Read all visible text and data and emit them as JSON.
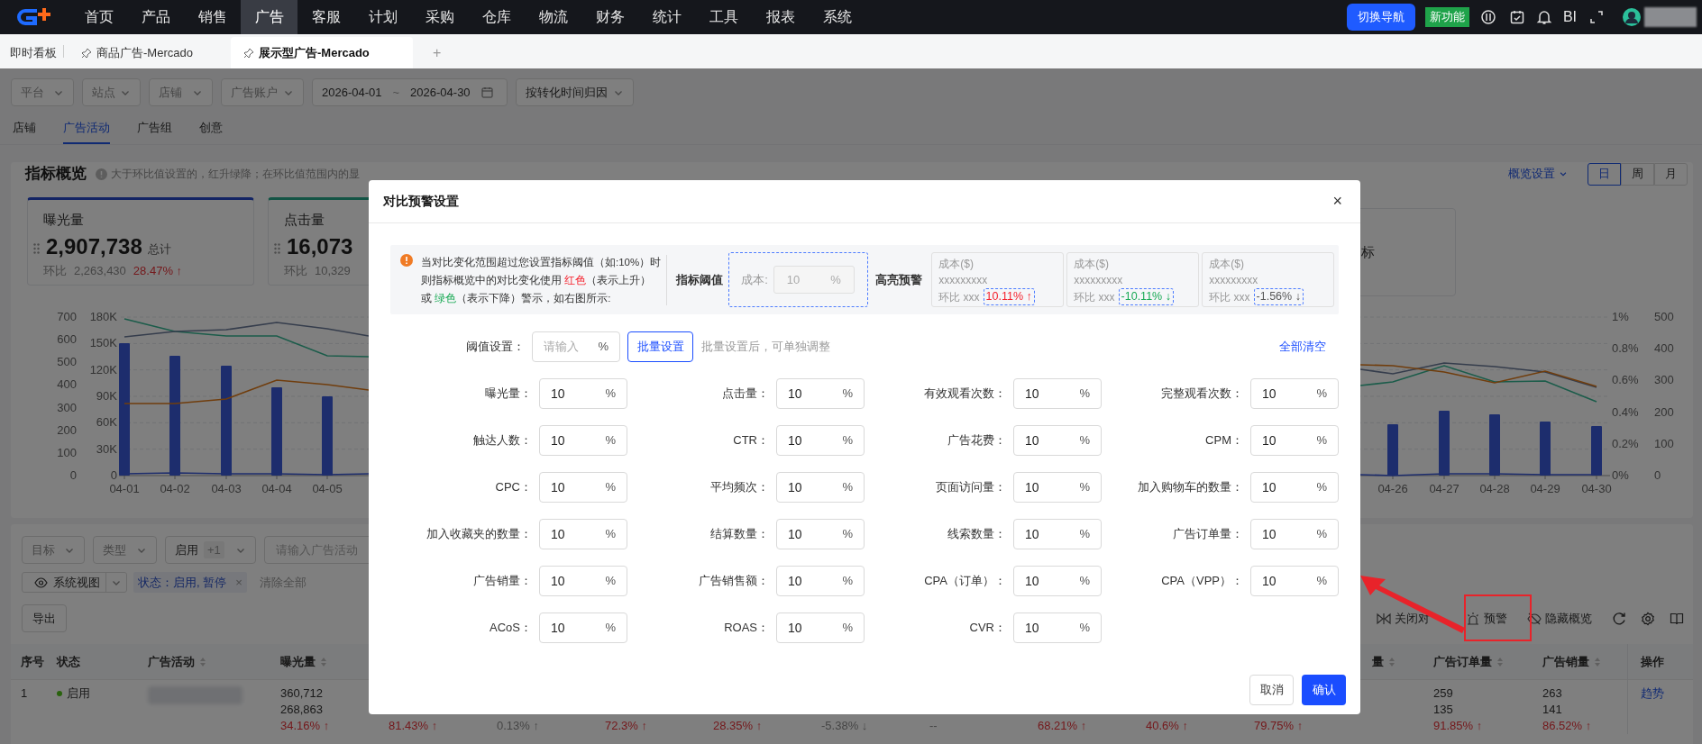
{
  "top_nav": {
    "items": [
      {
        "label": "首页",
        "selected": false
      },
      {
        "label": "产品",
        "selected": false
      },
      {
        "label": "销售",
        "selected": false
      },
      {
        "label": "广告",
        "selected": true
      },
      {
        "label": "客服",
        "selected": false
      },
      {
        "label": "计划",
        "selected": false
      },
      {
        "label": "采购",
        "selected": false
      },
      {
        "label": "仓库",
        "selected": false
      },
      {
        "label": "物流",
        "selected": false
      },
      {
        "label": "财务",
        "selected": false
      },
      {
        "label": "统计",
        "selected": false
      },
      {
        "label": "工具",
        "selected": false
      },
      {
        "label": "报表",
        "selected": false
      },
      {
        "label": "系统",
        "selected": false
      }
    ],
    "switch_button": "切换导航",
    "new_badge": "新功能",
    "bi_label": "BI"
  },
  "page_tabs": [
    {
      "label": "即时看板",
      "selected": false,
      "pinned": false
    },
    {
      "label": "商品广告-Mercado",
      "selected": false,
      "pinned": true
    },
    {
      "label": "展示型广告-Mercado",
      "selected": true,
      "pinned": true
    }
  ],
  "add_tab": "+",
  "filters": {
    "selects": [
      "平台",
      "站点",
      "店铺",
      "广告账户"
    ],
    "date_start": "2026-04-01",
    "date_separator": "~",
    "date_end": "2026-04-30",
    "attribution": "按转化时间归因"
  },
  "sub_tabs": [
    {
      "label": "店铺",
      "selected": false
    },
    {
      "label": "广告活动",
      "selected": true
    },
    {
      "label": "广告组",
      "selected": false
    },
    {
      "label": "创意",
      "selected": false
    }
  ],
  "overview": {
    "title": "指标概览",
    "hint": "大于环比值设置的，红升绿降；在环比值范围内的显",
    "settings": "概览设置",
    "periods": [
      {
        "label": "日",
        "selected": true
      },
      {
        "label": "周",
        "selected": false
      },
      {
        "label": "月",
        "selected": false
      }
    ],
    "cards": [
      {
        "title": "曝光量",
        "value": "2,907,738",
        "unit": "总计",
        "compare_label": "环比",
        "compare_value": "2,263,430",
        "change": "28.47% ↑",
        "alert": true
      },
      {
        "title": "点击量",
        "value": "16,073",
        "compare_label": "环比",
        "compare_value": "10,329"
      }
    ],
    "partial_card_text": "标",
    "chart": {
      "left_ticks": [
        "700",
        "600",
        "500",
        "400",
        "300",
        "200",
        "100",
        "0"
      ],
      "mid_ticks": [
        "180K",
        "150K",
        "120K",
        "90K",
        "60K",
        "30K",
        "0"
      ],
      "right_pct_ticks": [
        "1%",
        "0.8%",
        "0.6%",
        "0.4%",
        "0.2%",
        "0%"
      ],
      "right_ticks": [
        "500",
        "400",
        "300",
        "200",
        "100",
        "0"
      ],
      "x_labels_left": [
        "04-01",
        "04-02",
        "04-03",
        "04-04",
        "04-05"
      ],
      "x_labels_right": [
        "04-26",
        "04-27",
        "04-28",
        "04-29",
        "04-30"
      ]
    }
  },
  "table_filters": {
    "selects": [
      {
        "label": "目标"
      },
      {
        "label": "类型"
      },
      {
        "label": "启用",
        "extra": "+1"
      }
    ],
    "search_placeholder": "请输入广告活动",
    "view": "系统视图",
    "tag": "状态：启用, 暂停",
    "tag_close": "×",
    "clear": "清除全部",
    "export": "导出"
  },
  "table_actions": [
    {
      "label": "关闭对",
      "highlighted": false
    },
    {
      "label": "预警",
      "highlighted": true
    },
    {
      "label": "隐藏概览",
      "highlighted": false
    }
  ],
  "table": {
    "columns": [
      {
        "label": "序号",
        "sortable": false
      },
      {
        "label": "状态",
        "sortable": false
      },
      {
        "label": "广告活动",
        "sortable": true
      },
      {
        "label": "曝光量",
        "sortable": true
      },
      {},
      {},
      {},
      {},
      {},
      {},
      {},
      {},
      {
        "label": "量",
        "sortable": true
      },
      {
        "label": "广告订单量",
        "sortable": true
      },
      {
        "label": "广告销量",
        "sortable": true
      },
      {
        "label": "操作",
        "sortable": false
      }
    ],
    "rows": [
      {
        "cells": [
          {
            "kind": "text",
            "text": "1"
          },
          {
            "kind": "status",
            "text": "启用"
          },
          {
            "kind": "blurred"
          },
          {
            "kind": "metric",
            "lines": [
              "360,712",
              "268,863"
            ],
            "change": "34.16% ↑",
            "alert": true
          },
          {
            "kind": "change",
            "change": "81.43% ↑",
            "alert": true
          },
          {
            "kind": "change",
            "change": "0.13% ↑",
            "alert": false
          },
          {
            "kind": "change",
            "change": "72.3% ↑",
            "alert": true
          },
          {
            "kind": "change",
            "change": "28.35% ↑",
            "alert": true
          },
          {
            "kind": "change",
            "change": "-5.38% ↓",
            "alert": false
          },
          {
            "kind": "change",
            "change": "--",
            "alert": false
          },
          {
            "kind": "change",
            "change": "68.21% ↑",
            "alert": true
          },
          {
            "kind": "change",
            "change": "40.6% ↑",
            "alert": true
          },
          {
            "kind": "change",
            "change": "79.75% ↑",
            "alert": true
          },
          {
            "kind": "metric",
            "lines": [
              "259",
              "135"
            ],
            "change": "91.85% ↑",
            "alert": true
          },
          {
            "kind": "metric",
            "lines": [
              "263",
              "141"
            ],
            "change": "86.52% ↑",
            "alert": true
          },
          {
            "kind": "action",
            "text": "趋势"
          }
        ]
      }
    ]
  },
  "modal": {
    "title": "对比预警设置",
    "close": "×",
    "notice_lines": [
      [
        {
          "text": "当对比变化范围超过您设置指标阈值（如:10%）时"
        }
      ],
      [
        {
          "text": "则指标概览中的对比变化使用 "
        },
        {
          "text": "红色",
          "color": "#f5222d"
        },
        {
          "text": "（表示上升）"
        }
      ],
      [
        {
          "text": "或 "
        },
        {
          "text": "绿色",
          "color": "#1aaa55"
        },
        {
          "text": "（表示下降）警示，如右图所示:"
        }
      ]
    ],
    "threshold_label": "指标阈值",
    "sample_input": {
      "label": "成本:",
      "value": "10",
      "unit": "%",
      "disabled": true
    },
    "highlight_label": "高亮预警",
    "samples": [
      {
        "title": "成本($)",
        "value": "xxxxxxxxx",
        "compare": "环比 xxx",
        "change": "10.11% ↑",
        "color": "#f5222d"
      },
      {
        "title": "成本($)",
        "value": "xxxxxxxxx",
        "compare": "环比 xxx",
        "change": "-10.11% ↓",
        "color": "#1aaa55"
      },
      {
        "title": "成本($)",
        "value": "xxxxxxxxx",
        "compare": "环比 xxx",
        "change": "-1.56% ↓",
        "color": "#595959"
      }
    ],
    "batch": {
      "label": "阈值设置：",
      "placeholder": "请输入",
      "unit": "%",
      "button": "批量设置",
      "hint": "批量设置后，可单独调整",
      "clear": "全部清空"
    },
    "fields": [
      {
        "label": "曝光量：",
        "value": "10",
        "unit": "%"
      },
      {
        "label": "点击量：",
        "value": "10",
        "unit": "%"
      },
      {
        "label": "有效观看次数：",
        "value": "10",
        "unit": "%"
      },
      {
        "label": "完整观看次数：",
        "value": "10",
        "unit": "%"
      },
      {
        "label": "触达人数：",
        "value": "10",
        "unit": "%"
      },
      {
        "label": "CTR：",
        "value": "10",
        "unit": "%"
      },
      {
        "label": "广告花费：",
        "value": "10",
        "unit": "%"
      },
      {
        "label": "CPM：",
        "value": "10",
        "unit": "%"
      },
      {
        "label": "CPC：",
        "value": "10",
        "unit": "%"
      },
      {
        "label": "平均频次：",
        "value": "10",
        "unit": "%"
      },
      {
        "label": "页面访问量：",
        "value": "10",
        "unit": "%"
      },
      {
        "label": "加入购物车的数量：",
        "value": "10",
        "unit": "%"
      },
      {
        "label": "加入收藏夹的数量：",
        "value": "10",
        "unit": "%"
      },
      {
        "label": "结算数量：",
        "value": "10",
        "unit": "%"
      },
      {
        "label": "线索数量：",
        "value": "10",
        "unit": "%"
      },
      {
        "label": "广告订单量：",
        "value": "10",
        "unit": "%"
      },
      {
        "label": "广告销量：",
        "value": "10",
        "unit": "%"
      },
      {
        "label": "广告销售额：",
        "value": "10",
        "unit": "%"
      },
      {
        "label": "CPA（订单）：",
        "value": "10",
        "unit": "%"
      },
      {
        "label": "CPA（VPP）：",
        "value": "10",
        "unit": "%"
      },
      {
        "label": "ACoS：",
        "value": "10",
        "unit": "%"
      },
      {
        "label": "ROAS：",
        "value": "10",
        "unit": "%"
      },
      {
        "label": "CVR：",
        "value": "10",
        "unit": "%"
      }
    ],
    "cancel": "取消",
    "confirm": "确认"
  }
}
